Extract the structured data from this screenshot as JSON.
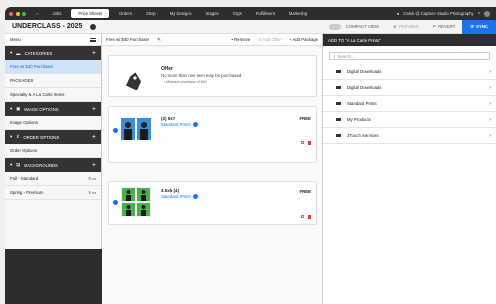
{
  "nav": {
    "items": [
      "Jobs",
      "Price Sheets",
      "Orders",
      "Shop",
      "My Designs",
      "Stages",
      "Orgs",
      "Fulfillment",
      "Marketing"
    ],
    "active": "Price Sheets",
    "user": "Caleb @ Capture Studio Photography"
  },
  "titlebar": {
    "project": "UNDERCLASS - 2025",
    "compact_view": "COMPACT VIEW",
    "preview": "PREVIEW",
    "revert": "REVERT",
    "sync": "SYNC"
  },
  "sidebar": {
    "menu": "Menu",
    "sections": [
      {
        "title": "CATEGORIES",
        "items": [
          {
            "label": "Free w/ $40 Purchase!",
            "selected": true
          },
          {
            "label": "PACKAGES"
          },
          {
            "label": "Specialty & A La Carte Items"
          }
        ]
      },
      {
        "title": "IMAGE OPTIONS",
        "items": [
          {
            "label": "Image Options"
          }
        ]
      },
      {
        "title": "ORDER OPTIONS",
        "items": [
          {
            "label": "Order Options"
          }
        ]
      },
      {
        "title": "BACKGROUNDS",
        "items": [
          {
            "label": "Fall - Standard",
            "count": "9"
          },
          {
            "label": "Spring - Premium",
            "count": "9"
          }
        ]
      }
    ]
  },
  "main": {
    "title": "Free w/ $40 Purchase!",
    "remove": "Remove",
    "add_offer": "Add Offer",
    "add_package": "Add Package",
    "offer": {
      "title": "Offer",
      "desc": "No more than one item may be purchased.",
      "min": "Minimum purchase of $40"
    },
    "products": [
      {
        "name": "(2) 5x7",
        "link": "Standard Prints",
        "price": "FREE"
      },
      {
        "name": "3.5x5 (4)",
        "link": "Standard Prints",
        "price": "FREE"
      }
    ]
  },
  "right": {
    "title": "ADD TO \"A La Carte Prints\"",
    "search_placeholder": "Search...",
    "folders": [
      "Digital Downloads",
      "Digital Downloads",
      "Standard Prints",
      "My Products",
      "3Touch Services"
    ]
  },
  "colors": {
    "accent": "#1a73e8",
    "dark": "#2d2d2d",
    "selected_bg": "#cfe3fb",
    "danger": "#e53935"
  }
}
